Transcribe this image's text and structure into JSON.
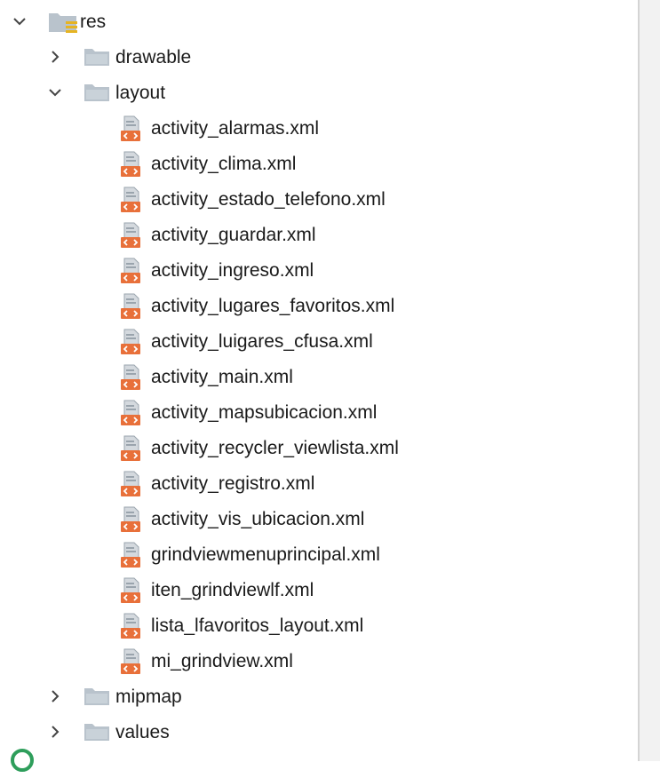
{
  "tree": {
    "root": {
      "label": "res",
      "expanded": true,
      "icon": "resource-folder-icon"
    },
    "folders": [
      {
        "label": "drawable",
        "expanded": false,
        "icon": "folder-icon"
      },
      {
        "label": "layout",
        "expanded": true,
        "icon": "folder-icon"
      },
      {
        "label": "mipmap",
        "expanded": false,
        "icon": "folder-icon"
      },
      {
        "label": "values",
        "expanded": false,
        "icon": "folder-icon"
      }
    ],
    "layout_files": [
      "activity_alarmas.xml",
      "activity_clima.xml",
      "activity_estado_telefono.xml",
      "activity_guardar.xml",
      "activity_ingreso.xml",
      "activity_lugares_favoritos.xml",
      "activity_luigares_cfusa.xml",
      "activity_main.xml",
      "activity_mapsubicacion.xml",
      "activity_recycler_viewlista.xml",
      "activity_registro.xml",
      "activity_vis_ubicacion.xml",
      "grindviewmenuprincipal.xml",
      "iten_grindviewlf.xml",
      "lista_lfavoritos_layout.xml",
      "mi_grindview.xml"
    ],
    "file_icon": "layout-xml-file-icon"
  },
  "colors": {
    "folder": "#b9c3cc",
    "xml_badge": "#e8703a",
    "chevron": "#444444",
    "resource_lines": "#e6b422"
  }
}
